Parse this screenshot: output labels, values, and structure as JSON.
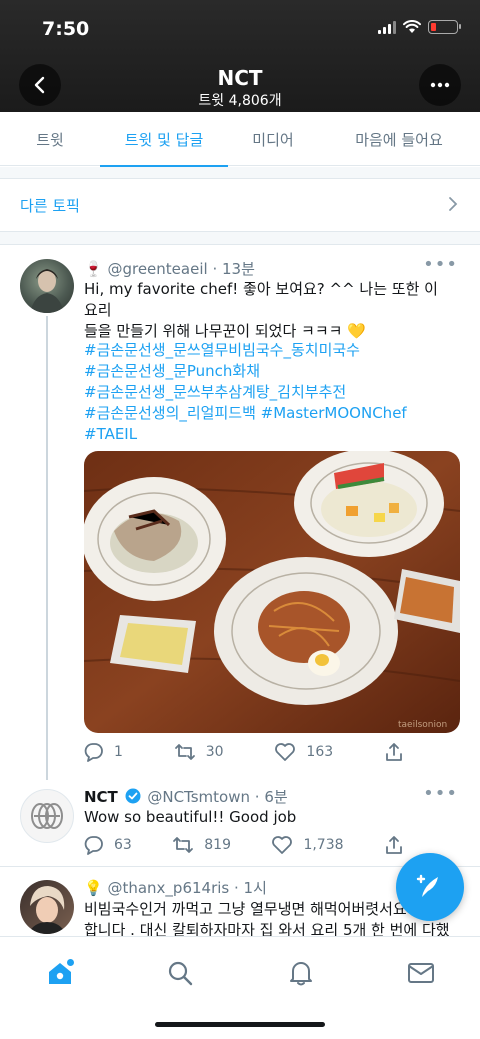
{
  "status_bar": {
    "time": "7:50"
  },
  "header": {
    "title": "NCT",
    "subtitle": "트윗 4,806개"
  },
  "tabs": [
    {
      "label": "트윗",
      "active": false
    },
    {
      "label": "트윗 및 답글",
      "active": true
    },
    {
      "label": "미디어",
      "active": false
    },
    {
      "label": "마음에 들어요",
      "active": false
    }
  ],
  "topic_link": "다른 토픽",
  "tweets": [
    {
      "emoji": "🍷",
      "handle": "@greenteaeil",
      "time": "· 13분",
      "text_line1": "Hi, my favorite chef! 좋아 보여요? ^^ 나는 또한 이 요리",
      "text_line2": "들을 만들기 위해 나무꾼이 되었다 ㅋㅋㅋ 💛",
      "hashtags": [
        "#금손문선생_문쓰열무비빔국수_동치미국수",
        "#금손문선생_문Punch화채",
        "#금손문선생_문쓰부추삼계탕_김치부추전",
        "#금손문선생의_리얼피드백 #MasterMOONChef",
        "#TAEIL"
      ],
      "photo_watermark": "taeilsonion",
      "replies": "1",
      "retweets": "30",
      "likes": "163"
    },
    {
      "name": "NCT",
      "handle": "@NCTsmtown",
      "time": "· 6분",
      "text": "Wow so beautiful!! Good job",
      "replies": "63",
      "retweets": "819",
      "likes": "1,738"
    },
    {
      "emoji": "💡",
      "handle": "@thanx_p614ris",
      "time": "· 1시",
      "text_line1": "비빔국수인거 까먹고 그냥 열무냉면 해먹어버렷서요",
      "text_line2": "합니다 . 대신 칼퇴하자마자 집 와서 요리 5개 한 번에 다했"
    }
  ],
  "icons": {
    "back": "chevron-left-icon",
    "more": "more-horizontal-icon",
    "verified": "verified-badge-icon",
    "compose": "compose-tweet-icon",
    "nav": [
      "home-icon",
      "search-icon",
      "notifications-icon",
      "messages-icon"
    ]
  },
  "colors": {
    "accent": "#1da1f2",
    "header_bg": "#1b1b1b",
    "muted": "#657786"
  }
}
